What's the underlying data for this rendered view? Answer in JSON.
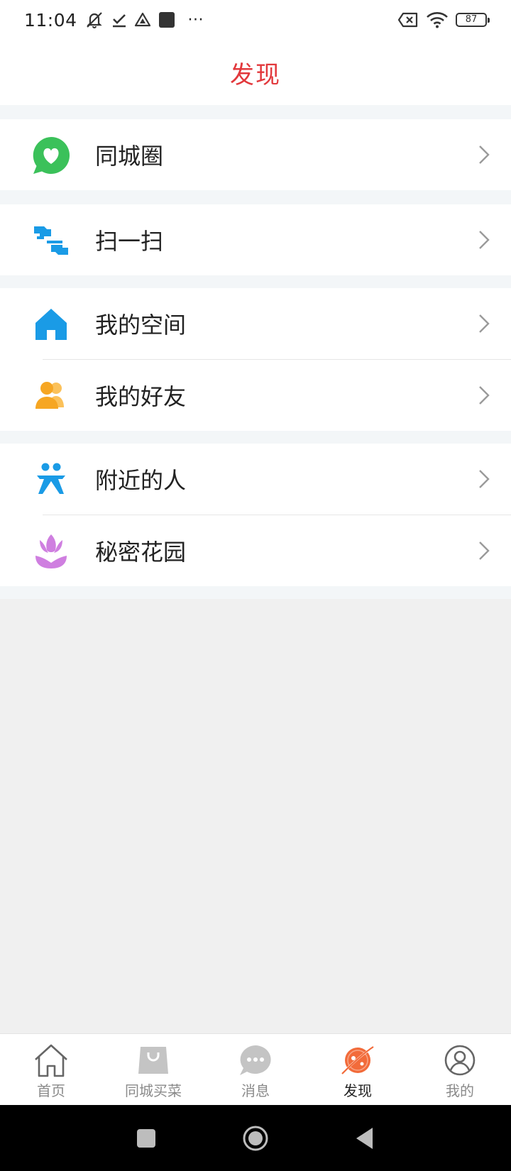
{
  "status_bar": {
    "time": "11:04",
    "more": "···",
    "battery": "87"
  },
  "header": {
    "title": "发现"
  },
  "menu": {
    "moments": {
      "label": "同城圈",
      "icon": "chat-heart-icon",
      "color": "#3bc15a"
    },
    "scan": {
      "label": "扫一扫",
      "icon": "scan-icon",
      "color": "#1a9be6"
    },
    "my_space": {
      "label": "我的空间",
      "icon": "home-icon",
      "color": "#1a9be6"
    },
    "my_friends": {
      "label": "我的好友",
      "icon": "friends-icon",
      "color": "#f6a623"
    },
    "nearby": {
      "label": "附近的人",
      "icon": "nearby-people-icon",
      "color": "#1a9be6"
    },
    "secret_garden": {
      "label": "秘密花园",
      "icon": "tulip-icon",
      "color": "#cf7fe0"
    }
  },
  "tabs": {
    "home": {
      "label": "首页",
      "icon": "house-icon"
    },
    "grocery": {
      "label": "同城买菜",
      "icon": "shopping-bag-icon"
    },
    "messages": {
      "label": "消息",
      "icon": "chat-bubble-icon"
    },
    "discover": {
      "label": "发现",
      "icon": "planet-icon",
      "color": "#f26b3a"
    },
    "mine": {
      "label": "我的",
      "icon": "user-circle-icon"
    }
  },
  "colors": {
    "accent": "#e2383c",
    "discover_active": "#f26b3a"
  }
}
